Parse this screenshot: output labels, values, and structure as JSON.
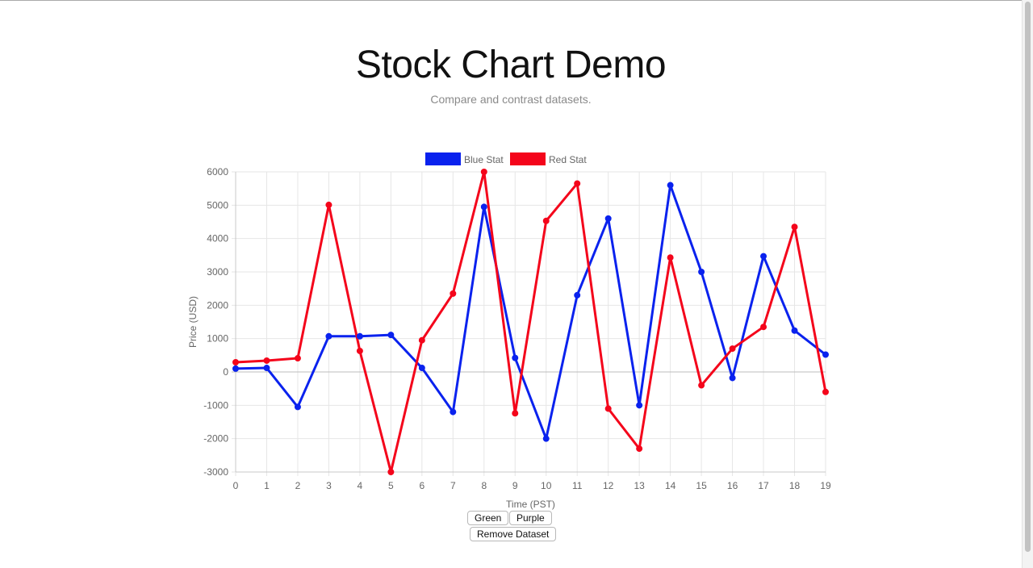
{
  "header": {
    "title": "Stock Chart Demo",
    "subtitle": "Compare and contrast datasets."
  },
  "controls": {
    "green_label": "Green",
    "purple_label": "Purple",
    "remove_label": "Remove Dataset"
  },
  "chart_data": {
    "type": "line",
    "x": [
      0,
      1,
      2,
      3,
      4,
      5,
      6,
      7,
      8,
      9,
      10,
      11,
      12,
      13,
      14,
      15,
      16,
      17,
      18,
      19
    ],
    "xlabel": "Time (PST)",
    "ylabel": "Price (USD)",
    "ylim": [
      -3000,
      6000
    ],
    "yticks": [
      6000,
      5000,
      4000,
      3000,
      2000,
      1000,
      0,
      -1000,
      -2000,
      -3000
    ],
    "grid": true,
    "legend_position": "top",
    "series": [
      {
        "name": "Blue Stat",
        "color": "#0a22ee",
        "values": [
          100,
          120,
          -1050,
          1070,
          1070,
          1110,
          120,
          -1200,
          4950,
          420,
          -2000,
          2300,
          4600,
          -1000,
          5600,
          3000,
          -180,
          3470,
          1240,
          520
        ]
      },
      {
        "name": "Red Stat",
        "color": "#f4051b",
        "values": [
          290,
          340,
          410,
          5010,
          630,
          -3000,
          950,
          2350,
          6000,
          -1240,
          4530,
          5650,
          -1100,
          -2300,
          3430,
          -400,
          700,
          1350,
          4350,
          -600
        ]
      }
    ]
  }
}
